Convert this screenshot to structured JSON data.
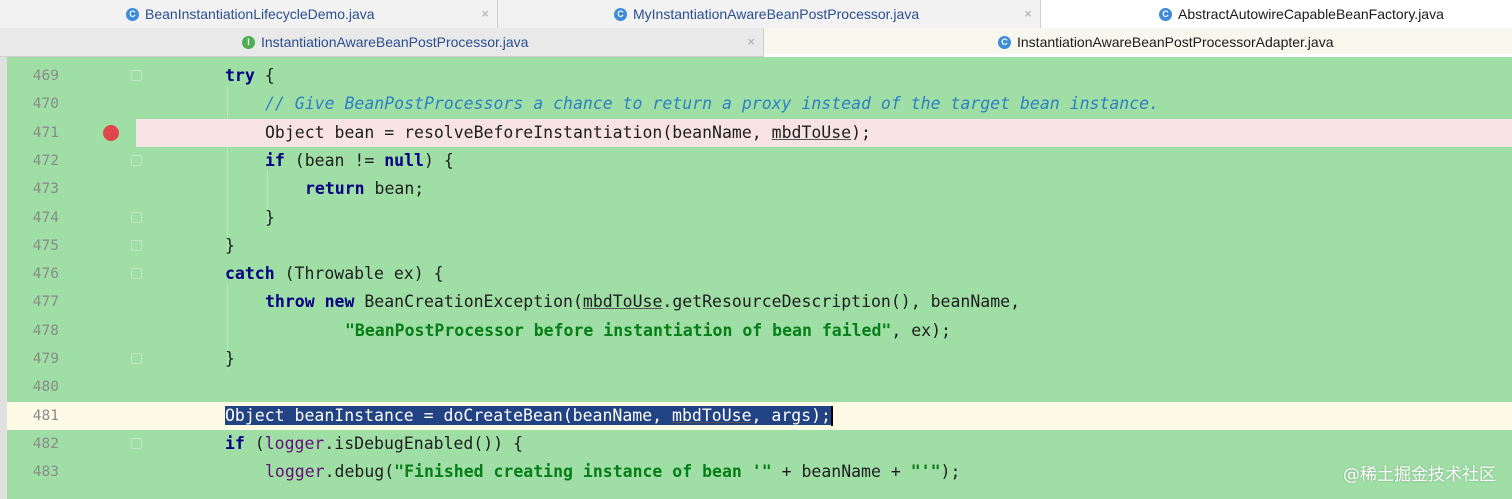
{
  "tabs_row1": [
    {
      "label": "BeanInstantiationLifecycleDemo.java",
      "icon": "class-icon",
      "active": false
    },
    {
      "label": "MyInstantiationAwareBeanPostProcessor.java",
      "icon": "class-icon",
      "active": false
    },
    {
      "label": "AbstractAutowireCapableBeanFactory.java",
      "icon": "class-icon",
      "active": true
    }
  ],
  "tabs_row2": [
    {
      "label": "InstantiationAwareBeanPostProcessor.java",
      "icon": "interface-icon",
      "active": false
    },
    {
      "label": "InstantiationAwareBeanPostProcessorAdapter.java",
      "icon": "class-icon",
      "active": true
    }
  ],
  "close_glyph": "×",
  "icon_letters": {
    "class": "C",
    "interface": "I"
  },
  "line_numbers": [
    "469",
    "470",
    "471",
    "472",
    "473",
    "474",
    "475",
    "476",
    "477",
    "478",
    "479",
    "480",
    "481",
    "482",
    "483"
  ],
  "code": {
    "l469": {
      "kw": "try",
      "rest": " {"
    },
    "l470": {
      "comment": "// Give BeanPostProcessors a chance to return a proxy instead of the target bean instance."
    },
    "l471": {
      "a": "Object bean = resolveBeforeInstantiation(beanName, ",
      "u": "mbdToUse",
      "b": ");"
    },
    "l472": {
      "kw": "if",
      "a": " (bean != ",
      "kw2": "null",
      "b": ") {"
    },
    "l473": {
      "kw": "return",
      "rest": " bean;"
    },
    "l474": {
      "rest": "}"
    },
    "l475": {
      "rest": "}"
    },
    "l476": {
      "kw": "catch",
      "rest": " (Throwable ex) {"
    },
    "l477": {
      "kw": "throw",
      "kw2": "new",
      "a": " BeanCreationException(",
      "u": "mbdToUse",
      "b": ".getResourceDescription(), beanName,"
    },
    "l478": {
      "str": "\"BeanPostProcessor before instantiation of bean failed\"",
      "rest": ", ex);"
    },
    "l479": {
      "rest": "}"
    },
    "l480": {
      "rest": ""
    },
    "l481": {
      "a": "Object beanInstance = doCreateBean(beanName, ",
      "u": "mbdToUse",
      "b": ", args);"
    },
    "l482": {
      "kw": "if",
      "a": " (",
      "fld": "logger",
      "b": ".isDebugEnabled()) {"
    },
    "l483": {
      "fld": "logger",
      "a": ".debug(",
      "str": "\"Finished creating instance of bean '\"",
      "b": " + beanName + ",
      "str2": "\"'\"",
      "c": ");"
    }
  },
  "breakpoint_line": "471",
  "current_line": "481",
  "watermark": "@稀土掘金技术社区",
  "colors": {
    "editor_bg": "#9fdfa6",
    "keyword": "#000080",
    "comment": "#2f7fc4",
    "string": "#067d17",
    "selection": "#214283",
    "breakpoint": "#e0464e"
  }
}
